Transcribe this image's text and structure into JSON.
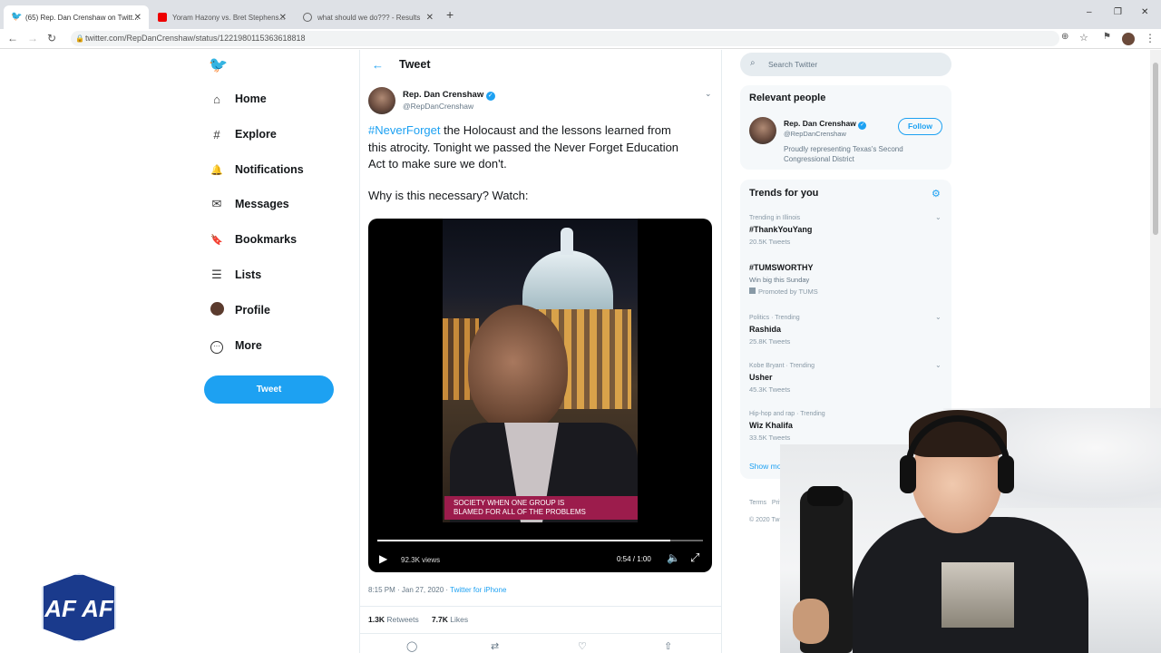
{
  "browser": {
    "tabs": [
      {
        "title": "(65) Rep. Dan Crenshaw on Twitt...",
        "active": true
      },
      {
        "title": "Yoram Hazony vs. Bret Stephens...",
        "active": false
      },
      {
        "title": "what should we do??? - Results",
        "active": false
      }
    ],
    "new_tab": "+",
    "url": "twitter.com/RepDanCrenshaw/status/1221980115363618818",
    "window_controls": {
      "minimize": "–",
      "maximize": "❐",
      "close": "✕"
    }
  },
  "nav": {
    "items": [
      {
        "label": "Home",
        "icon": "home-icon",
        "glyph": "⌂"
      },
      {
        "label": "Explore",
        "icon": "hashtag-icon",
        "glyph": "#"
      },
      {
        "label": "Notifications",
        "icon": "bell-icon",
        "glyph": "🔔"
      },
      {
        "label": "Messages",
        "icon": "envelope-icon",
        "glyph": "✉"
      },
      {
        "label": "Bookmarks",
        "icon": "bookmark-icon",
        "glyph": "🔖"
      },
      {
        "label": "Lists",
        "icon": "list-icon",
        "glyph": "☰"
      },
      {
        "label": "Profile",
        "icon": "avatar-icon",
        "glyph": "●"
      },
      {
        "label": "More",
        "icon": "more-icon",
        "glyph": "⋯"
      }
    ],
    "tweet_button": "Tweet"
  },
  "header": {
    "back": "←",
    "title": "Tweet"
  },
  "tweet": {
    "author_name": "Rep. Dan Crenshaw",
    "author_handle": "@RepDanCrenshaw",
    "hashtag": "#NeverForget",
    "text_line1": " the Holocaust and the lessons learned from",
    "text_line2": "this atrocity. Tonight we passed the Never Forget Education",
    "text_line3": "Act to make sure we don't.",
    "text_line4": "Why is this necessary? Watch:",
    "video": {
      "caption_line1": "SOCIETY WHEN ONE GROUP IS",
      "caption_line2": "BLAMED FOR ALL OF THE PROBLEMS",
      "views": "92.3K views",
      "time": "0:54 / 1:00",
      "progress": 0.9
    },
    "timestamp": "8:15 PM · Jan 27, 2020 · ",
    "source": "Twitter for iPhone",
    "retweets_count": "1.3K",
    "retweets_label": "Retweets",
    "likes_count": "7.7K",
    "likes_label": "Likes"
  },
  "search": {
    "placeholder": "Search Twitter"
  },
  "relevant": {
    "title": "Relevant people",
    "name": "Rep. Dan Crenshaw",
    "handle": "@RepDanCrenshaw",
    "bio_line1": "Proudly representing Texas's Second",
    "bio_line2": "Congressional District",
    "follow": "Follow"
  },
  "trends": {
    "title": "Trends for you",
    "items": [
      {
        "context": "Trending in Illinois",
        "name": "#ThankYouYang",
        "count": "20.5K Tweets"
      },
      {
        "context": "",
        "name": "#TUMSWORTHY",
        "count": "Win big this Sunday",
        "promo": "Promoted by TUMS"
      },
      {
        "context": "Politics · Trending",
        "name": "Rashida",
        "count": "25.8K Tweets"
      },
      {
        "context": "Kobe Bryant · Trending",
        "name": "Usher",
        "count": "45.3K Tweets"
      },
      {
        "context": "Hip-hop and rap · Trending",
        "name": "Wiz Khalifa",
        "count": "33.5K Tweets"
      }
    ],
    "show_more": "Show more"
  },
  "footer": {
    "links": "Terms   Privacy policy   Cookies   Ads info   More",
    "copyright": "© 2020 Twitter, Inc."
  },
  "logo": {
    "text": "AF AF"
  },
  "colors": {
    "twitter_blue": "#1da1f2",
    "caption_bg": "#9c1c4c"
  }
}
